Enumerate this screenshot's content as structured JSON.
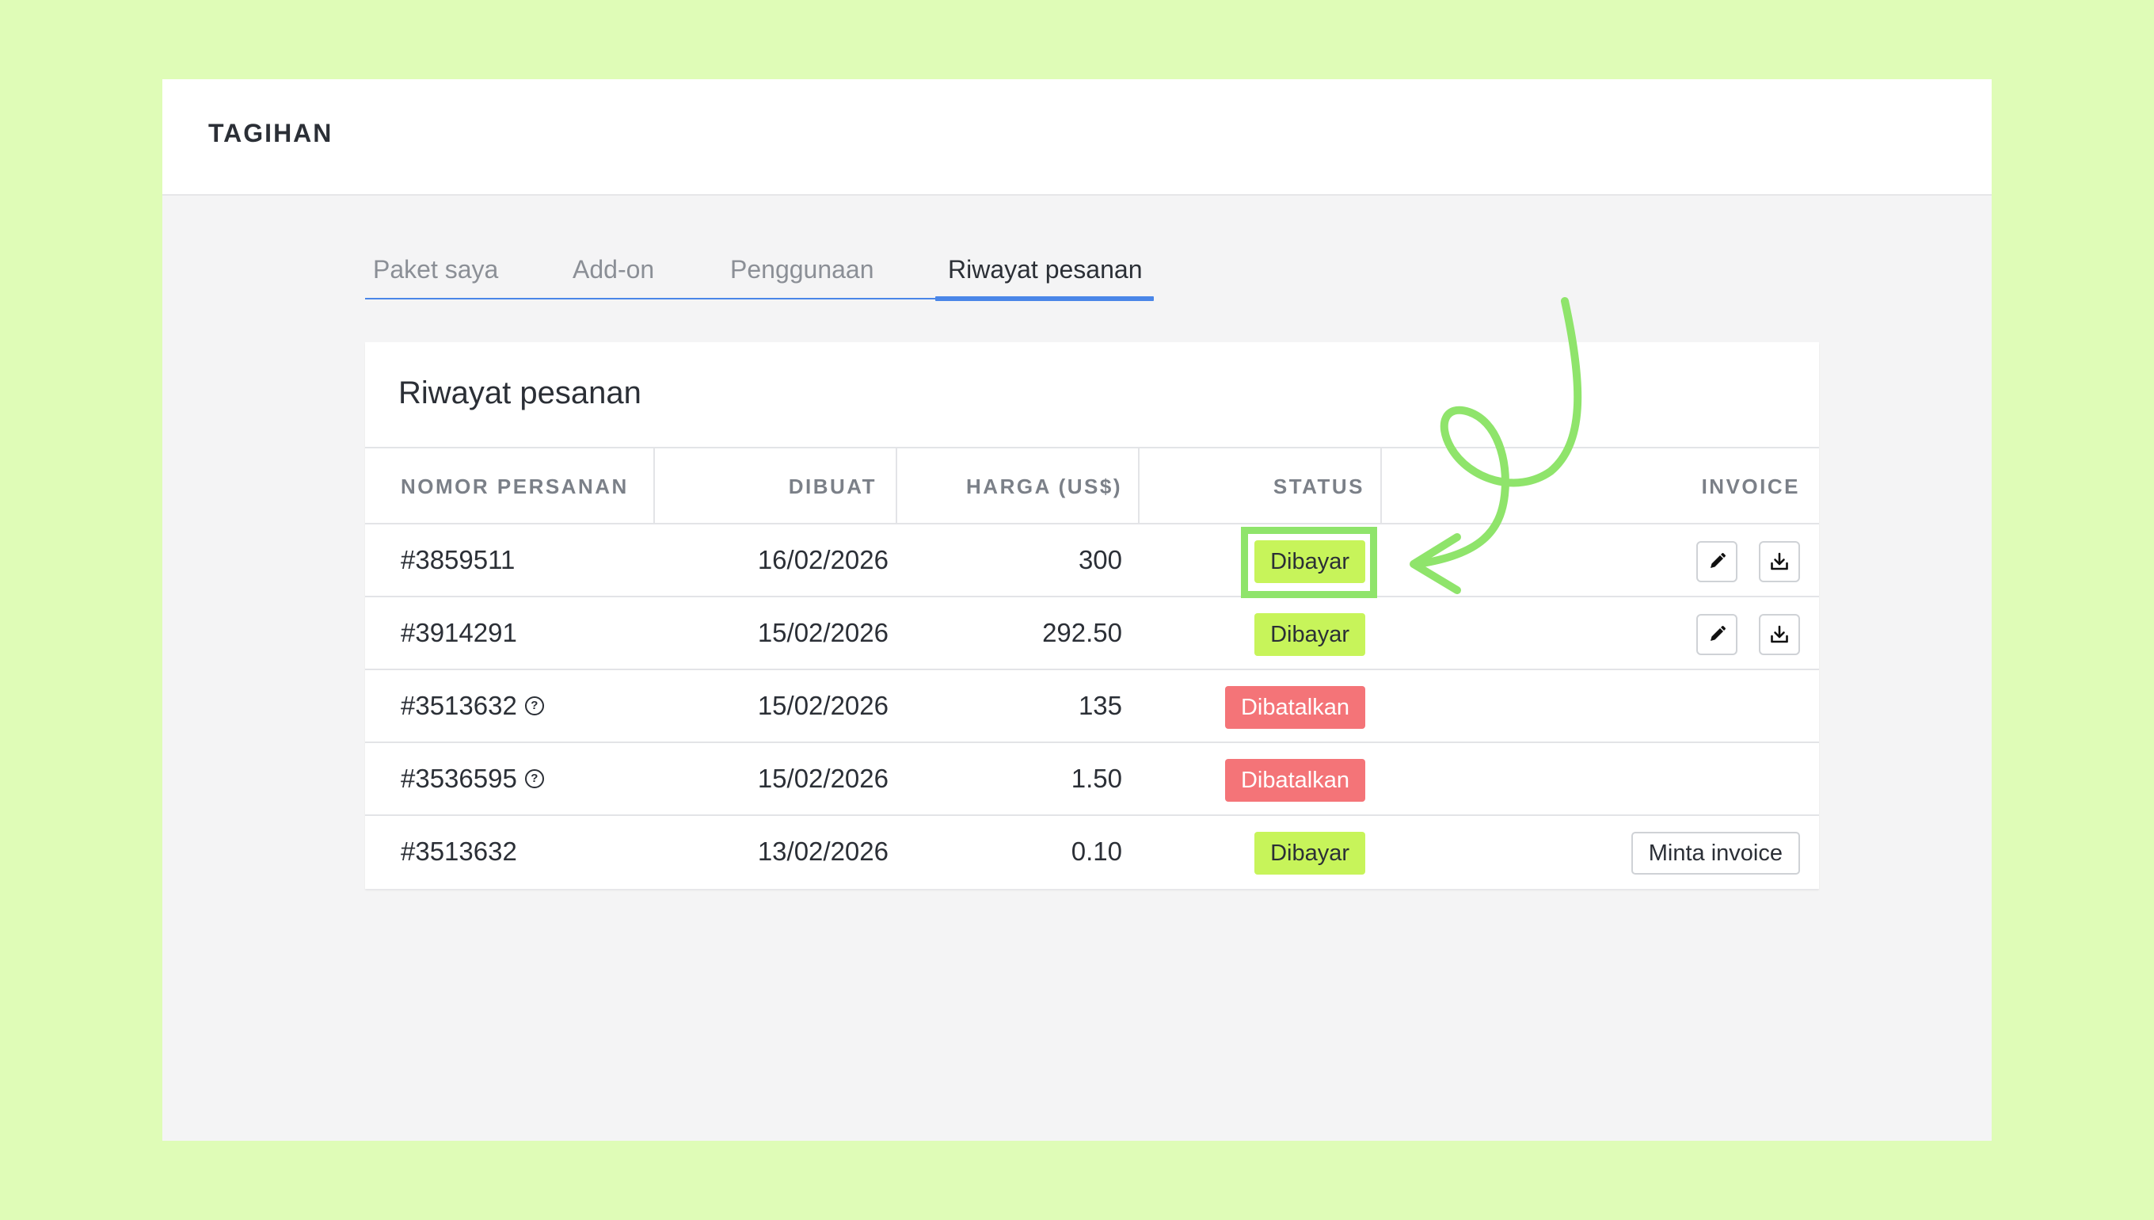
{
  "header": {
    "title": "TAGIHAN"
  },
  "tabs": [
    {
      "label": "Paket saya",
      "active": false
    },
    {
      "label": "Add-on",
      "active": false
    },
    {
      "label": "Penggunaan",
      "active": false
    },
    {
      "label": "Riwayat pesanan",
      "active": true
    }
  ],
  "card": {
    "title": "Riwayat pesanan"
  },
  "table": {
    "columns": [
      "NOMOR PERSANAN",
      "DIBUAT",
      "HARGA (US$)",
      "STATUS",
      "INVOICE"
    ],
    "rows": [
      {
        "order": "#3859511",
        "help": false,
        "created": "16/02/2026",
        "price": "300",
        "status": "Dibayar",
        "status_type": "paid",
        "invoice": "icons"
      },
      {
        "order": "#3914291",
        "help": false,
        "created": "15/02/2026",
        "price": "292.50",
        "status": "Dibayar",
        "status_type": "paid",
        "invoice": "icons"
      },
      {
        "order": "#3513632",
        "help": true,
        "created": "15/02/2026",
        "price": "135",
        "status": "Dibatalkan",
        "status_type": "cancel",
        "invoice": "none"
      },
      {
        "order": "#3536595",
        "help": true,
        "created": "15/02/2026",
        "price": "1.50",
        "status": "Dibatalkan",
        "status_type": "cancel",
        "invoice": "none"
      },
      {
        "order": "#3513632",
        "help": false,
        "created": "13/02/2026",
        "price": "0.10",
        "status": "Dibayar",
        "status_type": "paid",
        "invoice": "button"
      }
    ],
    "request_invoice_label": "Minta invoice",
    "help_glyph": "?"
  },
  "icons": {
    "help": "question-circle-icon",
    "edit": "pencil-icon",
    "download": "download-icon"
  },
  "colors": {
    "background": "#dffcb7",
    "paid_badge": "#c7f45a",
    "cancel_badge": "#f47478",
    "tab_accent": "#4a86e8",
    "annotation": "#8fe46b"
  }
}
